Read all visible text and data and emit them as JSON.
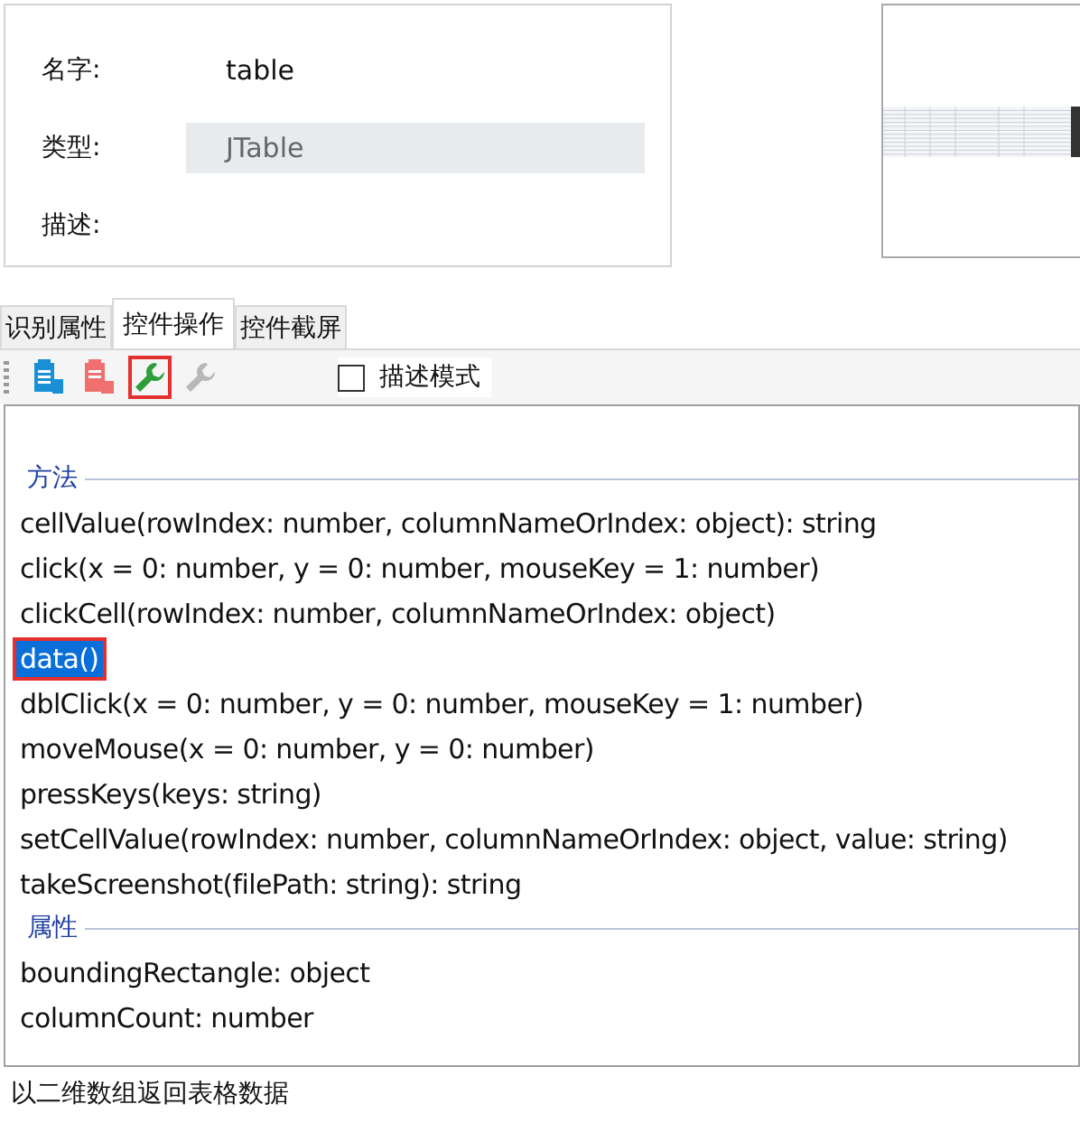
{
  "properties": [
    {
      "label": "名字:",
      "value": "table",
      "kind": "text"
    },
    {
      "label": "类型:",
      "value": "JTable",
      "kind": "readonly"
    },
    {
      "label": "描述:",
      "kind": "text"
    }
  ],
  "tabs": [
    {
      "label": "识别属性",
      "selected": false
    },
    {
      "label": "控件操作",
      "selected": true
    },
    {
      "label": "控件截屏",
      "selected": false
    }
  ],
  "toolbar": {
    "buttons": [
      {
        "kind": "copy",
        "highlighted": false,
        "disabled": false
      },
      {
        "kind": "paste",
        "highlighted": false,
        "disabled": false
      },
      {
        "kind": "wrench",
        "highlighted": true,
        "disabled": false
      },
      {
        "kind": "wrench",
        "highlighted": false,
        "disabled": true
      }
    ],
    "checkbox": {
      "label": "描述模式",
      "checked": false
    }
  },
  "sections": [
    {
      "title": "方法",
      "items": [
        {
          "text": "cellValue(rowIndex: number, columnNameOrIndex: object): string",
          "selected": false
        },
        {
          "text": "click(x = 0: number, y = 0: number, mouseKey = 1: number)",
          "selected": false
        },
        {
          "text": "clickCell(rowIndex: number, columnNameOrIndex: object)",
          "selected": false
        },
        {
          "text": "data()",
          "selected": true
        },
        {
          "text": "dblClick(x = 0: number, y = 0: number, mouseKey = 1: number)",
          "selected": false
        },
        {
          "text": "moveMouse(x = 0: number, y = 0: number)",
          "selected": false
        },
        {
          "text": "pressKeys(keys: string)",
          "selected": false
        },
        {
          "text": "setCellValue(rowIndex: number, columnNameOrIndex: object, value: string)",
          "selected": false
        },
        {
          "text": "takeScreenshot(filePath: string): string",
          "selected": false
        }
      ]
    },
    {
      "title": "属性",
      "items": [
        {
          "text": "boundingRectangle: object",
          "selected": false
        },
        {
          "text": "columnCount: number",
          "selected": false
        }
      ]
    }
  ],
  "status_bar": "以二维数组返回表格数据"
}
